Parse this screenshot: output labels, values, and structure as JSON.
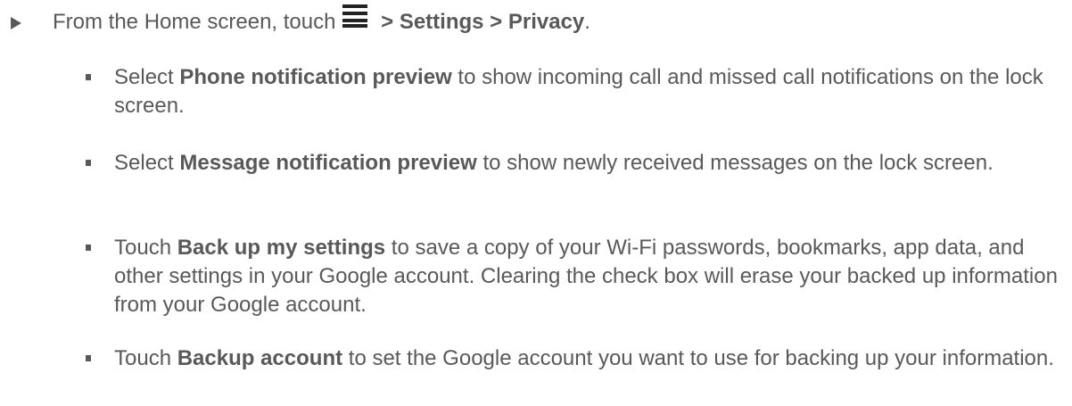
{
  "step": {
    "pre": "From the Home screen, touch",
    "post_sep1": " > ",
    "settings": "Settings",
    "post_sep2": " > ",
    "privacy": "Privacy",
    "end": ".",
    "icon": "menu-icon"
  },
  "items": [
    {
      "pre": "Select ",
      "bold": "Phone notification preview",
      "post": " to show incoming call and missed call notifications on the lock screen."
    },
    {
      "pre": "Select ",
      "bold": "Message notification preview",
      "post": " to show newly received messages on the lock screen."
    },
    {
      "pre": "Touch ",
      "bold": "Back up my settings",
      "post": " to save a copy of your Wi-Fi passwords, bookmarks, app data, and other settings in your Google account. Clearing the check box will erase your backed up information from your Google account."
    },
    {
      "pre": "Touch ",
      "bold": "Backup account",
      "post": " to set the Google account you want to use for backing up your information."
    }
  ],
  "colors": {
    "text": "#595959",
    "icon": "#222222"
  }
}
